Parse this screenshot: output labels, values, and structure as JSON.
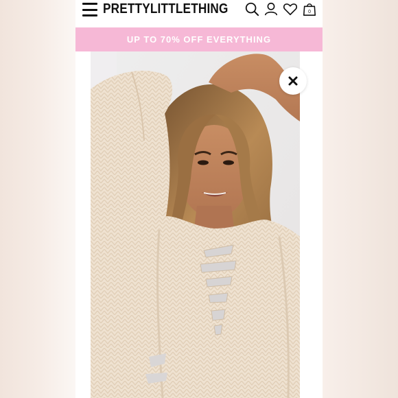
{
  "header": {
    "brand": "PRETTYLITTLETHING",
    "menu_icon": "hamburger-menu-icon",
    "search_icon": "search-icon",
    "account_icon": "user-icon",
    "wishlist_icon": "heart-icon",
    "bag_icon": "shopping-bag-icon",
    "bag_count": "0"
  },
  "promo": {
    "text": "UP TO 70% OFF EVERYTHING",
    "background": "#f6b8d6",
    "color": "#ffffff"
  },
  "product": {
    "image_icon": "product-photo",
    "close_icon": "close-icon"
  }
}
